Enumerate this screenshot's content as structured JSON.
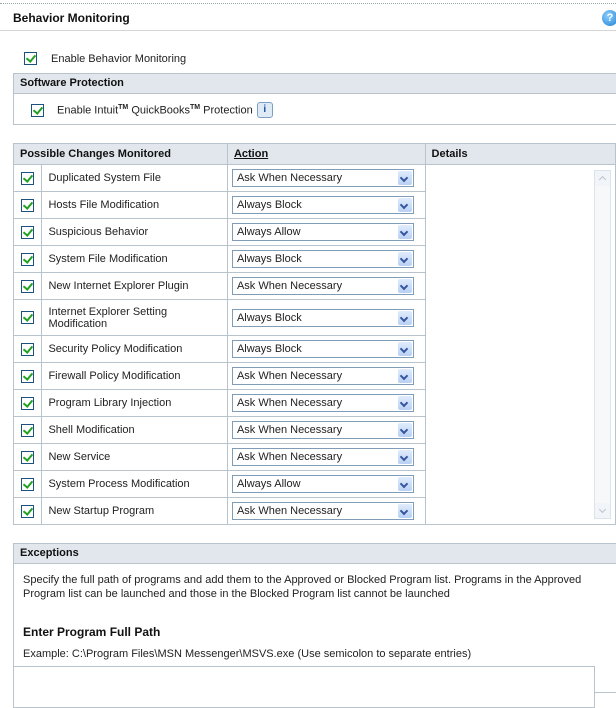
{
  "page": {
    "title": "Behavior Monitoring",
    "help_icon_glyph": "?"
  },
  "enable_behavior": {
    "label": "Enable Behavior Monitoring",
    "checked": true
  },
  "software_protection": {
    "header": "Software Protection",
    "label_part1": "Enable Intuit",
    "tm": "TM",
    "label_part2": " QuickBooks",
    "label_part3": " Protection",
    "info_icon_glyph": "i",
    "checked": true
  },
  "monitor_table": {
    "col_changes": "Possible Changes Monitored",
    "col_action": "Action",
    "col_details": "Details",
    "rows": [
      {
        "name": "Duplicated System File",
        "action": "Ask When Necessary",
        "checked": true
      },
      {
        "name": "Hosts File Modification",
        "action": "Always Block",
        "checked": true
      },
      {
        "name": "Suspicious Behavior",
        "action": "Always Allow",
        "checked": true
      },
      {
        "name": "System File Modification",
        "action": "Always Block",
        "checked": true
      },
      {
        "name": "New Internet Explorer Plugin",
        "action": "Ask When Necessary",
        "checked": true
      },
      {
        "name": "Internet Explorer Setting Modification",
        "action": "Always Block",
        "checked": true
      },
      {
        "name": "Security Policy Modification",
        "action": "Always Block",
        "checked": true
      },
      {
        "name": "Firewall Policy Modification",
        "action": "Ask When Necessary",
        "checked": true
      },
      {
        "name": "Program Library Injection",
        "action": "Ask When Necessary",
        "checked": true
      },
      {
        "name": "Shell Modification",
        "action": "Ask When Necessary",
        "checked": true
      },
      {
        "name": "New Service",
        "action": "Ask When Necessary",
        "checked": true
      },
      {
        "name": "System Process Modification",
        "action": "Always Allow",
        "checked": true
      },
      {
        "name": "New Startup Program",
        "action": "Ask When Necessary",
        "checked": true
      }
    ]
  },
  "exceptions": {
    "header": "Exceptions",
    "description": "Specify the full path of programs and add them to the Approved or Blocked Program list. Programs in the Approved Program list can be launched and those in the Blocked Program list cannot be launched",
    "path_heading": "Enter Program Full Path",
    "example": "Example: C:\\Program Files\\MSN Messenger\\MSVS.exe (Use semicolon to separate entries)",
    "path_value": ""
  },
  "colors": {
    "header_bg": "#e1e7ec",
    "border": "#b9c3cb",
    "check_green": "#21a121",
    "accent_blue": "#1e7fd0"
  }
}
